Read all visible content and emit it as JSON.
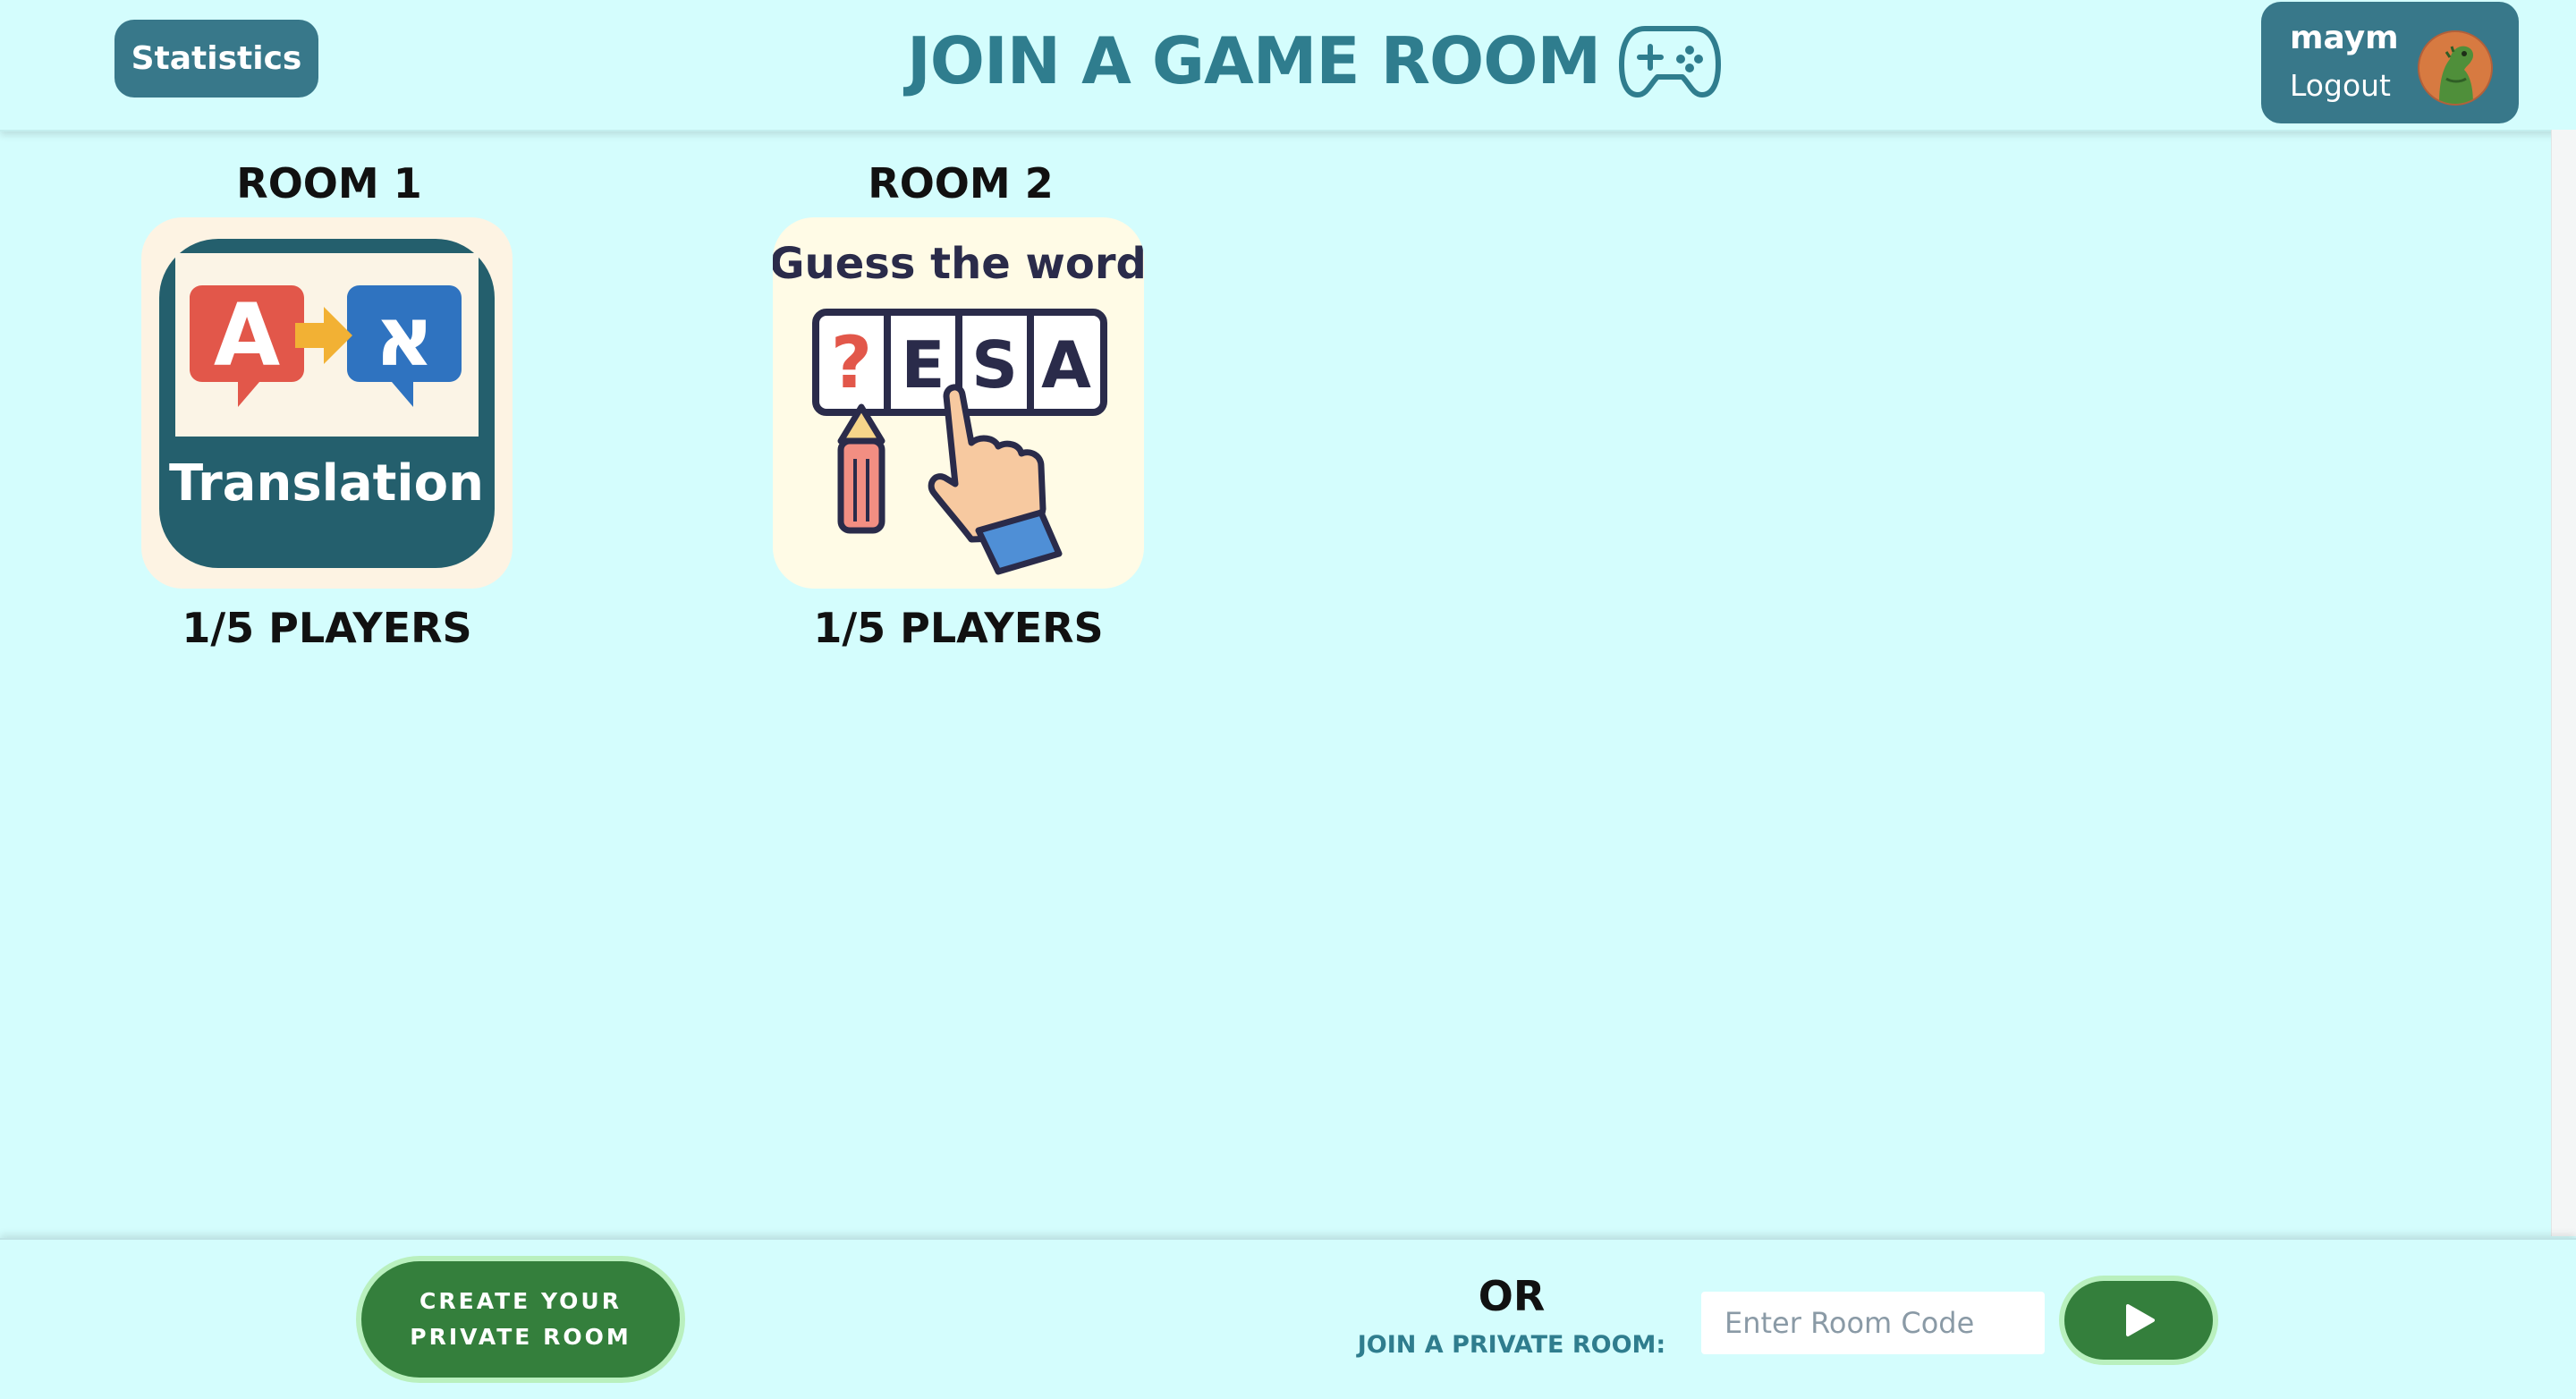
{
  "header": {
    "stats_label": "Statistics",
    "title": "JOIN A GAME ROOM",
    "title_icon": "gamepad-icon",
    "user": {
      "name": "maym",
      "logout_label": "Logout",
      "avatar_icon": "dinosaur-avatar-icon"
    }
  },
  "rooms": [
    {
      "title": "ROOM 1",
      "card_text": "Translation",
      "card_letters": [
        "A",
        "א"
      ],
      "players": "1/5 PLAYERS"
    },
    {
      "title": "ROOM 2",
      "card_text": "Guess the word",
      "card_letters": [
        "?",
        "E",
        "S",
        "A"
      ],
      "players": "1/5 PLAYERS"
    }
  ],
  "footer": {
    "create_line1": "CREATE YOUR",
    "create_line2": "PRIVATE ROOM",
    "or_label": "OR",
    "join_label": "JOIN A PRIVATE ROOM:",
    "code_placeholder": "Enter Room Code",
    "go_icon": "play-icon"
  },
  "colors": {
    "background": "#d4fdfd",
    "header_button": "#38788a",
    "title": "#2f7d8e",
    "green_button": "#347f3c",
    "translation_dark": "#245f6d",
    "bubble_red": "#e2574a",
    "bubble_blue": "#2f73c0",
    "arrow_orange": "#f2b134"
  }
}
